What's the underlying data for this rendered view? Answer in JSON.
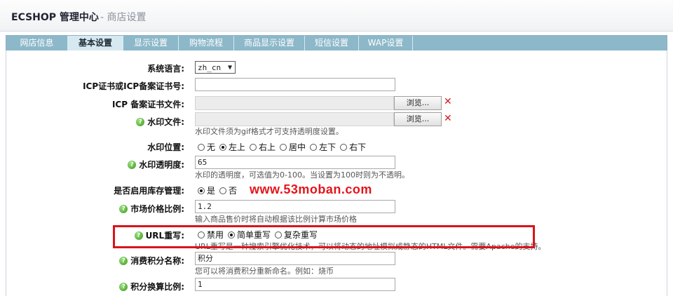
{
  "header": {
    "brand": "ECSHOP 管理中心",
    "crumb": "- 商店设置"
  },
  "tabs": [
    {
      "label": "网店信息",
      "active": false
    },
    {
      "label": "基本设置",
      "active": true
    },
    {
      "label": "显示设置",
      "active": false
    },
    {
      "label": "购物流程",
      "active": false
    },
    {
      "label": "商品显示设置",
      "active": false
    },
    {
      "label": "短信设置",
      "active": false
    },
    {
      "label": "WAP设置",
      "active": false
    }
  ],
  "form": {
    "lang": {
      "label": "系统语言:",
      "value": "zh_cn"
    },
    "icp_no": {
      "label": "ICP证书或ICP备案证书号:",
      "value": ""
    },
    "icp_file": {
      "label": "ICP 备案证书文件:",
      "browse": "浏览..."
    },
    "watermark_file": {
      "label": "水印文件:",
      "browse": "浏览...",
      "note": "水印文件须为gif格式才可支持透明度设置。"
    },
    "watermark_pos": {
      "label": "水印位置:",
      "options": [
        "无",
        "左上",
        "右上",
        "居中",
        "左下",
        "右下"
      ],
      "selected": "左上"
    },
    "watermark_alpha": {
      "label": "水印透明度:",
      "value": "65",
      "note": "水印的透明度，可选值为0-100。当设置为100时则为不透明。"
    },
    "stock": {
      "label": "是否启用库存管理:",
      "opt_yes": "是",
      "opt_no": "否",
      "selected": "是"
    },
    "market_ratio": {
      "label": "市场价格比例:",
      "value": "1.2",
      "note": "输入商品售价时将自动根据该比例计算市场价格"
    },
    "url_rewrite": {
      "label": "URL重写:",
      "options": [
        "禁用",
        "简单重写",
        "复杂重写"
      ],
      "selected": "简单重写",
      "note": "URL重写是一种搜索引擎优化技术，可以将动态的地址模拟成静态的HTML文件。需要Apache的支持。"
    },
    "points_name": {
      "label": "消费积分名称:",
      "value": "积分",
      "note": "您可以将消费积分重新命名。例如：烧币"
    },
    "points_ratio": {
      "label": "积分换算比例:",
      "value": "1"
    }
  },
  "watermark_text": "www.53moban.com",
  "colors": {
    "tab_bg": "#8cb8c9",
    "tab_active": "#d7e9f0",
    "highlight": "#d8141c",
    "help_icon": "#3c9a1e"
  }
}
